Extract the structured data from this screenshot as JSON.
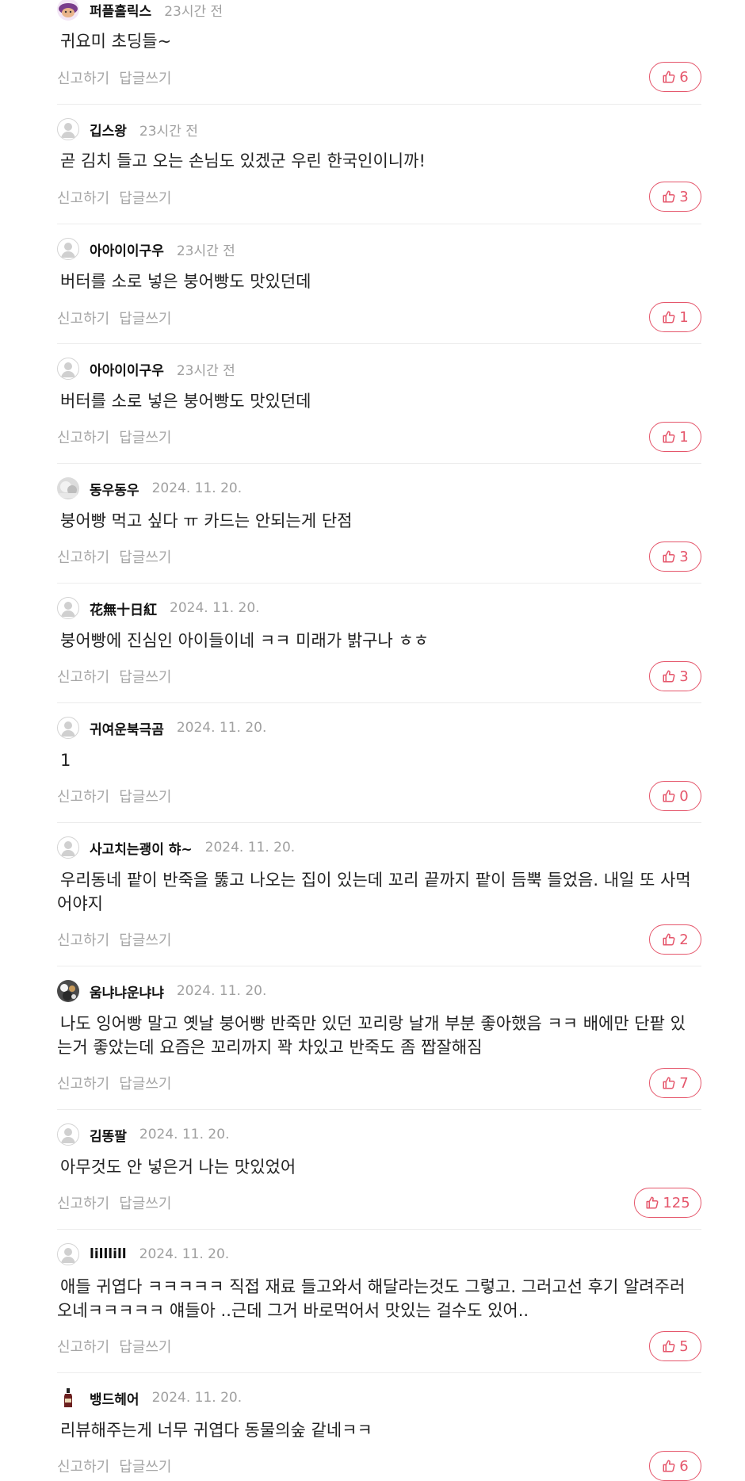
{
  "labels": {
    "report": "신고하기",
    "reply": "답글쓰기"
  },
  "comments": [
    {
      "author": "퍼플홀릭스",
      "time": "23시간 전",
      "text": "귀요미 초딩들~",
      "likes": "6",
      "avatar": "purple"
    },
    {
      "author": "깁스왕",
      "time": "23시간 전",
      "text": "곧 김치 들고 오는 손님도 있겠군 우린 한국인이니까!",
      "likes": "3",
      "avatar": "default"
    },
    {
      "author": "아아이이구우",
      "time": "23시간 전",
      "text": "버터를 소로 넣은 붕어빵도 맛있던데",
      "likes": "1",
      "avatar": "default"
    },
    {
      "author": "아아이이구우",
      "time": "23시간 전",
      "text": "버터를 소로 넣은 붕어빵도 맛있던데",
      "likes": "1",
      "avatar": "default"
    },
    {
      "author": "동우동우",
      "time": "2024. 11. 20.",
      "text": "붕어빵 먹고 싶다 ㅠ 카드는 안되는게 단점",
      "likes": "3",
      "avatar": "photo-grey"
    },
    {
      "author": "花無十日紅",
      "time": "2024. 11. 20.",
      "text": "붕어빵에 진심인 아이들이네 ㅋㅋ 미래가 밝구나 ㅎㅎ",
      "likes": "3",
      "avatar": "default"
    },
    {
      "author": "귀여운북극곰",
      "time": "2024. 11. 20.",
      "text": "1",
      "likes": "0",
      "avatar": "default"
    },
    {
      "author": "사고치는괭이 햐~",
      "time": "2024. 11. 20.",
      "text": "우리동네 팥이 반죽을 뚫고 나오는 집이 있는데 꼬리 끝까지 팥이 듬뿍 들었음. 내일 또 사먹어야지",
      "likes": "2",
      "avatar": "default"
    },
    {
      "author": "움냐냐운냐냐",
      "time": "2024. 11. 20.",
      "text": "나도 잉어빵 말고 옛날 붕어빵 반죽만 있던 꼬리랑 날개 부분 좋아했음 ㅋㅋ 배에만 단팥 있는거 좋았는데 요즘은 꼬리까지 꽉 차있고 반죽도 좀 짭잘해짐",
      "likes": "7",
      "avatar": "photo-dark"
    },
    {
      "author": "김똥팔",
      "time": "2024. 11. 20.",
      "text": "아무것도 안 넣은거 나는 맛있었어",
      "likes": "125",
      "avatar": "default"
    },
    {
      "author": "lilllill",
      "time": "2024. 11. 20.",
      "text": "애들 귀엽다 ㅋㅋㅋㅋㅋ 직접 재료 들고와서 해달라는것도 그렇고. 그러고선 후기 알려주러오네ㅋㅋㅋㅋㅋ 얘들아 ..근데 그거 바로먹어서 맛있는 걸수도 있어..",
      "likes": "5",
      "avatar": "default"
    },
    {
      "author": "뱅드헤어",
      "time": "2024. 11. 20.",
      "text": "리뷰해주는게 너무 귀엽다 동물의숲 같네ㅋㅋ",
      "likes": "6",
      "avatar": "bottle"
    }
  ]
}
